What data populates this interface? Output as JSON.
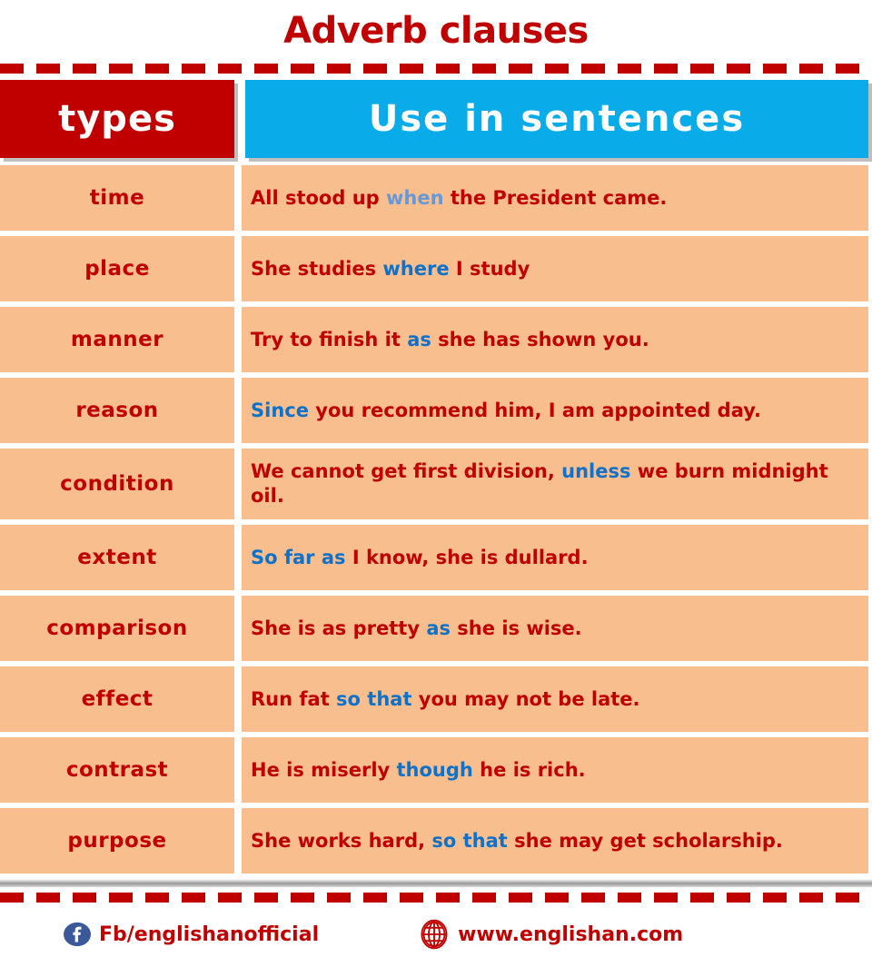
{
  "title": "Adverb clauses",
  "header": {
    "col_types": "types",
    "col_use": "Use in sentences"
  },
  "colors": {
    "title_red": "#C00000",
    "header_red": "#C00000",
    "header_blue": "#09ABE8",
    "row_peach": "#F9BE8E",
    "keyword_blue": "#0F72C8",
    "keyword_blue_light": "#6699D8",
    "facebook_blue": "#3B5998"
  },
  "rows": [
    {
      "type": "time",
      "parts": [
        {
          "text": "All stood up ",
          "style": "plain"
        },
        {
          "text": "when",
          "style": "kw-light"
        },
        {
          "text": " the President came.",
          "style": "plain"
        }
      ]
    },
    {
      "type": "place",
      "parts": [
        {
          "text": "She studies ",
          "style": "plain"
        },
        {
          "text": "where",
          "style": "kw"
        },
        {
          "text": " I study",
          "style": "plain"
        }
      ]
    },
    {
      "type": "manner",
      "parts": [
        {
          "text": "Try to finish it ",
          "style": "plain"
        },
        {
          "text": "as",
          "style": "kw"
        },
        {
          "text": " she has shown you.",
          "style": "plain"
        }
      ]
    },
    {
      "type": "reason",
      "parts": [
        {
          "text": "Since",
          "style": "kw"
        },
        {
          "text": " you recommend him, I am appointed day.",
          "style": "plain"
        }
      ]
    },
    {
      "type": "condition",
      "tall": true,
      "parts": [
        {
          "text": "We cannot get  first division, ",
          "style": "plain"
        },
        {
          "text": "unless",
          "style": "kw"
        },
        {
          "text": " we burn midnight oil.",
          "style": "plain"
        }
      ]
    },
    {
      "type": "extent",
      "parts": [
        {
          "text": "So far as",
          "style": "kw"
        },
        {
          "text": " I know, she is dullard.",
          "style": "plain"
        }
      ]
    },
    {
      "type": "comparison",
      "parts": [
        {
          "text": "She is as pretty ",
          "style": "plain"
        },
        {
          "text": "as",
          "style": "kw"
        },
        {
          "text": " she is wise.",
          "style": "plain"
        }
      ]
    },
    {
      "type": "effect",
      "parts": [
        {
          "text": "Run fat ",
          "style": "plain"
        },
        {
          "text": "so that",
          "style": "kw"
        },
        {
          "text": " you may not be late.",
          "style": "plain"
        }
      ]
    },
    {
      "type": "contrast",
      "parts": [
        {
          "text": "He is miserly ",
          "style": "plain"
        },
        {
          "text": "though",
          "style": "kw"
        },
        {
          "text": " he is rich.",
          "style": "plain"
        }
      ]
    },
    {
      "type": "purpose",
      "parts": [
        {
          "text": "She works hard, ",
          "style": "plain"
        },
        {
          "text": "so that",
          "style": "kw"
        },
        {
          "text": " she may get scholarship.",
          "style": "plain"
        }
      ]
    }
  ],
  "footer": {
    "facebook": {
      "icon": "facebook-icon",
      "label": "Fb/englishanofficial"
    },
    "website": {
      "icon": "globe-icon",
      "label": "www.englishan.com"
    }
  }
}
